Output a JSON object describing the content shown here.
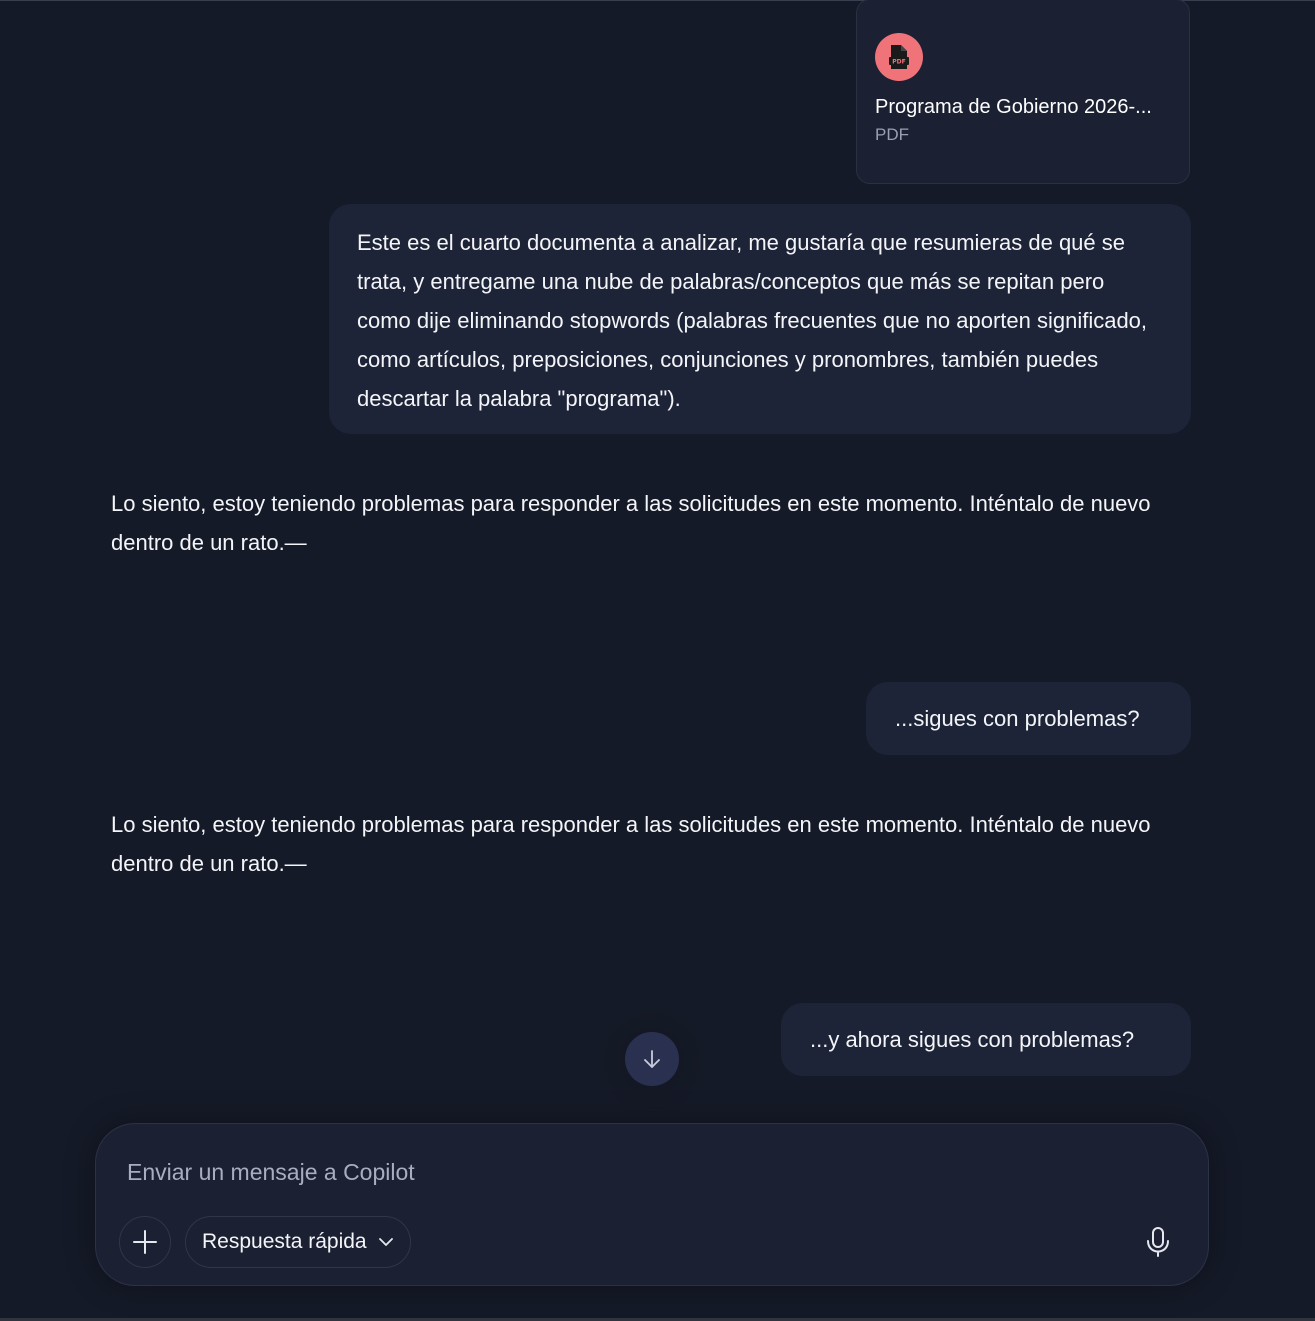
{
  "attachment": {
    "name": "Programa de Gobierno 2026-...",
    "type": "PDF",
    "icon": "pdf-file-icon",
    "icon_color": "#f0737a"
  },
  "messages": [
    {
      "role": "user",
      "text": "Este es el cuarto documenta a analizar, me gustaría que resumieras de qué se trata, y entregame una nube de palabras/conceptos que más se repitan pero como dije eliminando stopwords (palabras frecuentes que no aporten significado, como artículos, preposiciones, conjunciones y pronombres, también puedes descartar la palabra \"programa\")."
    },
    {
      "role": "assistant",
      "text": "Lo siento, estoy teniendo problemas para responder a las solicitudes en este momento. Inténtalo de nuevo dentro de un rato.—"
    },
    {
      "role": "user",
      "text": "...sigues con problemas?"
    },
    {
      "role": "assistant",
      "text": "Lo siento, estoy teniendo problemas para responder a las solicitudes en este momento. Inténtalo de nuevo dentro de un rato.—"
    },
    {
      "role": "user",
      "text": "...y ahora sigues con problemas?"
    }
  ],
  "scroll_button": {
    "icon": "arrow-down-icon"
  },
  "composer": {
    "placeholder": "Enviar un mensaje a Copilot",
    "value": "",
    "add_icon": "plus-icon",
    "mode_label": "Respuesta rápida",
    "mode_icon": "chevron-down-icon",
    "mic_icon": "microphone-icon"
  },
  "colors": {
    "background": "#151a28",
    "bubble": "#1e2438",
    "text": "#f4f5f8",
    "muted": "#9aa0b4"
  }
}
